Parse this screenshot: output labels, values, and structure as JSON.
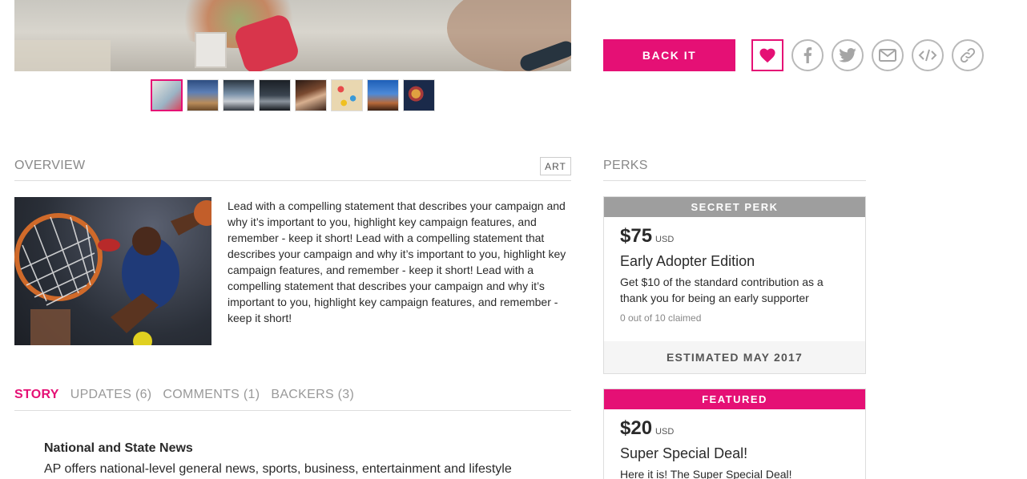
{
  "actions": {
    "back_label": "BACK IT",
    "icons": [
      "heart-icon",
      "facebook-icon",
      "twitter-icon",
      "email-icon",
      "embed-icon",
      "link-icon"
    ]
  },
  "overview": {
    "label": "OVERVIEW",
    "tag": "ART",
    "text": "Lead with a compelling statement that describes your campaign and why it’s important to you, highlight key campaign features, and remember - keep it short! Lead with a compelling statement that describes your campaign and why it’s important to you, highlight key campaign features, and remember - keep it short! Lead with a compelling statement that describes your campaign and why it’s important to you, highlight key campaign features, and remember - keep it short!"
  },
  "tabs": [
    {
      "label": "STORY"
    },
    {
      "label": "UPDATES (6)"
    },
    {
      "label": "COMMENTS (1)"
    },
    {
      "label": "BACKERS (3)"
    }
  ],
  "story": {
    "title": "National and State News",
    "body": "AP offers national-level general news, sports, business, entertainment and lifestyle"
  },
  "perks": {
    "label": "PERKS",
    "items": [
      {
        "banner": "SECRET PERK",
        "amount": "$75",
        "currency": "USD",
        "title": "Early Adopter Edition",
        "description": "Get $10 of the standard contribution as a thank you for being an early supporter",
        "claimed": "0 out of 10 claimed",
        "estimated": "ESTIMATED MAY 2017"
      },
      {
        "banner": "FEATURED",
        "amount": "$20",
        "currency": "USD",
        "title": "Super Special Deal!",
        "description": "Here it is! The Super Special Deal!"
      }
    ]
  },
  "colors": {
    "accent": "#e51075",
    "secret_banner": "#9e9e9e"
  }
}
